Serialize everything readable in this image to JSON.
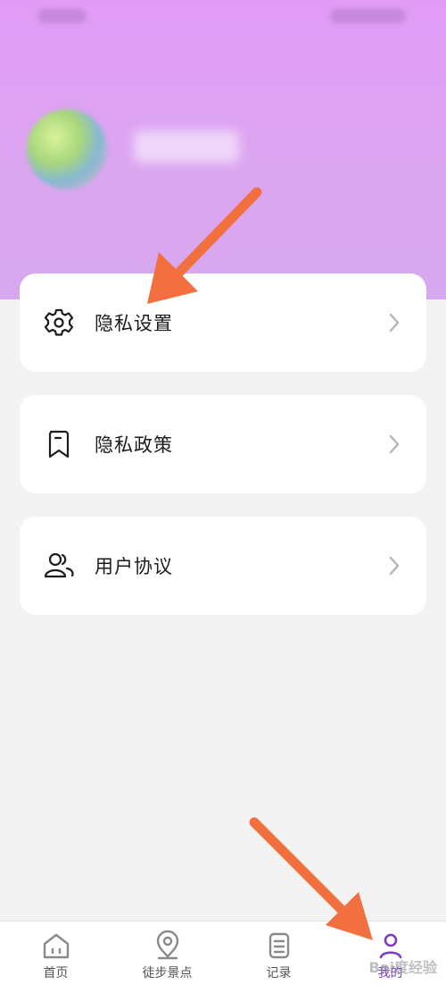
{
  "menu": {
    "items": [
      {
        "label": "隐私设置",
        "icon": "gear-icon"
      },
      {
        "label": "隐私政策",
        "icon": "bookmark-icon"
      },
      {
        "label": "用户协议",
        "icon": "users-icon"
      }
    ]
  },
  "tabbar": {
    "tabs": [
      {
        "label": "首页",
        "icon": "home-icon"
      },
      {
        "label": "徒步景点",
        "icon": "location-pin-icon"
      },
      {
        "label": "记录",
        "icon": "document-icon"
      },
      {
        "label": "我的",
        "icon": "person-icon",
        "active": true
      }
    ]
  },
  "watermark": {
    "text": "Bai度经验"
  },
  "colors": {
    "header_gradient_top": "#e29cf7",
    "active_tab": "#7a3dc9",
    "annotation_arrow": "#f2703f"
  }
}
